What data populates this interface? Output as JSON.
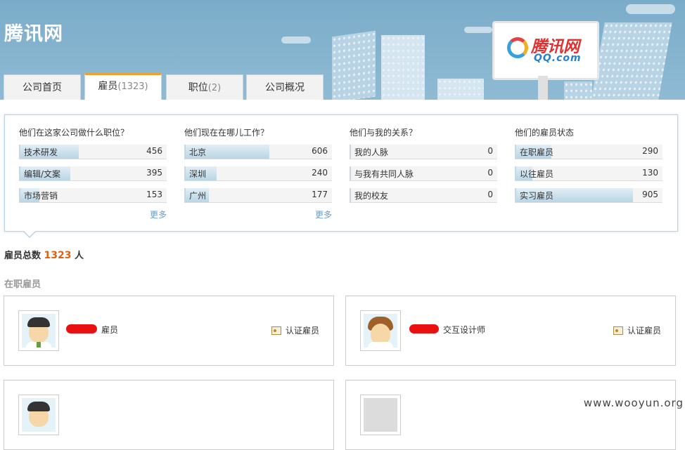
{
  "header": {
    "site_title": "腾讯网",
    "logo": {
      "text": "腾讯网",
      "sub": "QQ.com"
    }
  },
  "tabs": [
    {
      "label": "公司首页",
      "count": ""
    },
    {
      "label": "雇员",
      "count": "(1323)"
    },
    {
      "label": "职位",
      "count": "(2)"
    },
    {
      "label": "公司概况",
      "count": ""
    }
  ],
  "stats": [
    {
      "title": "他们在这家公司做什么职位？",
      "more": "更多",
      "rows": [
        {
          "label": "技术研发",
          "count": "456",
          "fill": 0.4
        },
        {
          "label": "编辑/文案",
          "count": "395",
          "fill": 0.34
        },
        {
          "label": "市场营销",
          "count": "153",
          "fill": 0.13
        }
      ]
    },
    {
      "title": "他们现在在哪儿工作？",
      "more": "更多",
      "rows": [
        {
          "label": "北京",
          "count": "606",
          "fill": 0.57
        },
        {
          "label": "深圳",
          "count": "240",
          "fill": 0.21
        },
        {
          "label": "广州",
          "count": "177",
          "fill": 0.16
        }
      ]
    },
    {
      "title": "他们与我的关系？",
      "more": "",
      "rows": [
        {
          "label": "我的人脉",
          "count": "0",
          "fill": 0
        },
        {
          "label": "与我有共同人脉",
          "count": "0",
          "fill": 0
        },
        {
          "label": "我的校友",
          "count": "0",
          "fill": 0
        }
      ]
    },
    {
      "title": "他们的雇员状态",
      "more": "",
      "rows": [
        {
          "label": "在职雇员",
          "count": "290",
          "fill": 0.24
        },
        {
          "label": "以往雇员",
          "count": "130",
          "fill": 0.11
        },
        {
          "label": "实习雇员",
          "count": "905",
          "fill": 0.8
        }
      ]
    }
  ],
  "total": {
    "prefix": "雇员总数",
    "count": "1323",
    "suffix": "人"
  },
  "section_title": "在职雇员",
  "cards": [
    {
      "title": "雇员",
      "verify": "认证雇员"
    },
    {
      "title": "交互设计师",
      "verify": "认证雇员"
    }
  ],
  "watermark": "www.wooyun.org"
}
